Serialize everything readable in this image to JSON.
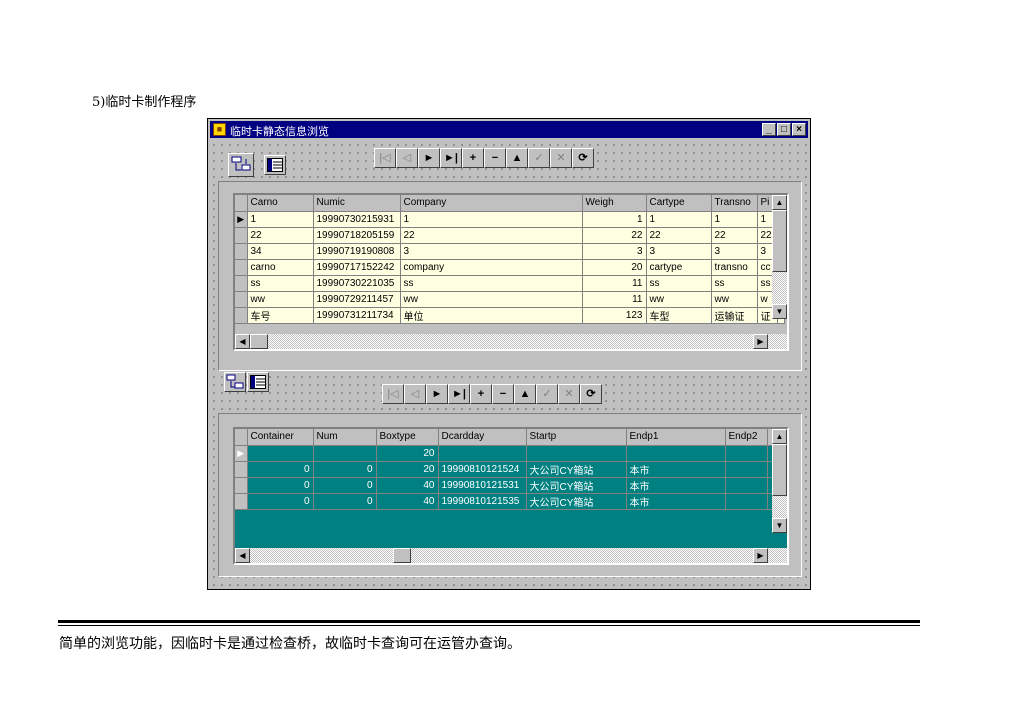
{
  "doc": {
    "heading": "5)临时卡制作程序",
    "caption": "简单的浏览功能，因临时卡是通过检查桥，故临时卡查询可在运管办查询。"
  },
  "window": {
    "title": "临时卡静态信息浏览",
    "minimize": "_",
    "maximize": "□",
    "close": "×"
  },
  "navigator": {
    "first": "|◁",
    "prior": "◁",
    "next": "►",
    "last": "►|",
    "insert": "+",
    "delete": "−",
    "edit": "▲",
    "post": "✓",
    "cancel": "✕",
    "refresh": "⟳"
  },
  "grid1": {
    "columns": [
      "Carno",
      "Numic",
      "Company",
      "Weigh",
      "Cartype",
      "Transno",
      "Pi"
    ],
    "rows": [
      [
        "1",
        "19990730215931",
        "1",
        "1",
        "1",
        "1",
        "1"
      ],
      [
        "22",
        "19990718205159",
        "22",
        "22",
        "22",
        "22",
        "22"
      ],
      [
        "34",
        "19990719190808",
        "3",
        "3",
        "3",
        "3",
        "3"
      ],
      [
        "carno",
        "19990717152242",
        "company",
        "20",
        "cartype",
        "transno",
        "cc"
      ],
      [
        "ss",
        "19990730221035",
        "ss",
        "11",
        "ss",
        "ss",
        "ss"
      ],
      [
        "ww",
        "19990729211457",
        "ww",
        "11",
        "ww",
        "ww",
        "w"
      ],
      [
        "车号",
        "19990731211734",
        "单位",
        "123",
        "车型",
        "运输证",
        "证"
      ]
    ]
  },
  "grid2": {
    "columns": [
      "Container",
      "Num",
      "Boxtype",
      "Dcardday",
      "Startp",
      "Endp1",
      "Endp2"
    ],
    "rows": [
      [
        "",
        "",
        "20",
        "",
        "",
        "",
        ""
      ],
      [
        "0",
        "0",
        "20",
        "19990810121524",
        "大公司CY箱站",
        "本市",
        ""
      ],
      [
        "0",
        "0",
        "40",
        "19990810121531",
        "大公司CY箱站",
        "本市",
        ""
      ],
      [
        "0",
        "0",
        "40",
        "19990810121535",
        "大公司CY箱站",
        "本市",
        ""
      ]
    ]
  },
  "indicator": "▶",
  "scroll": {
    "up": "▲",
    "down": "▼",
    "left": "◀",
    "right": "▶"
  }
}
